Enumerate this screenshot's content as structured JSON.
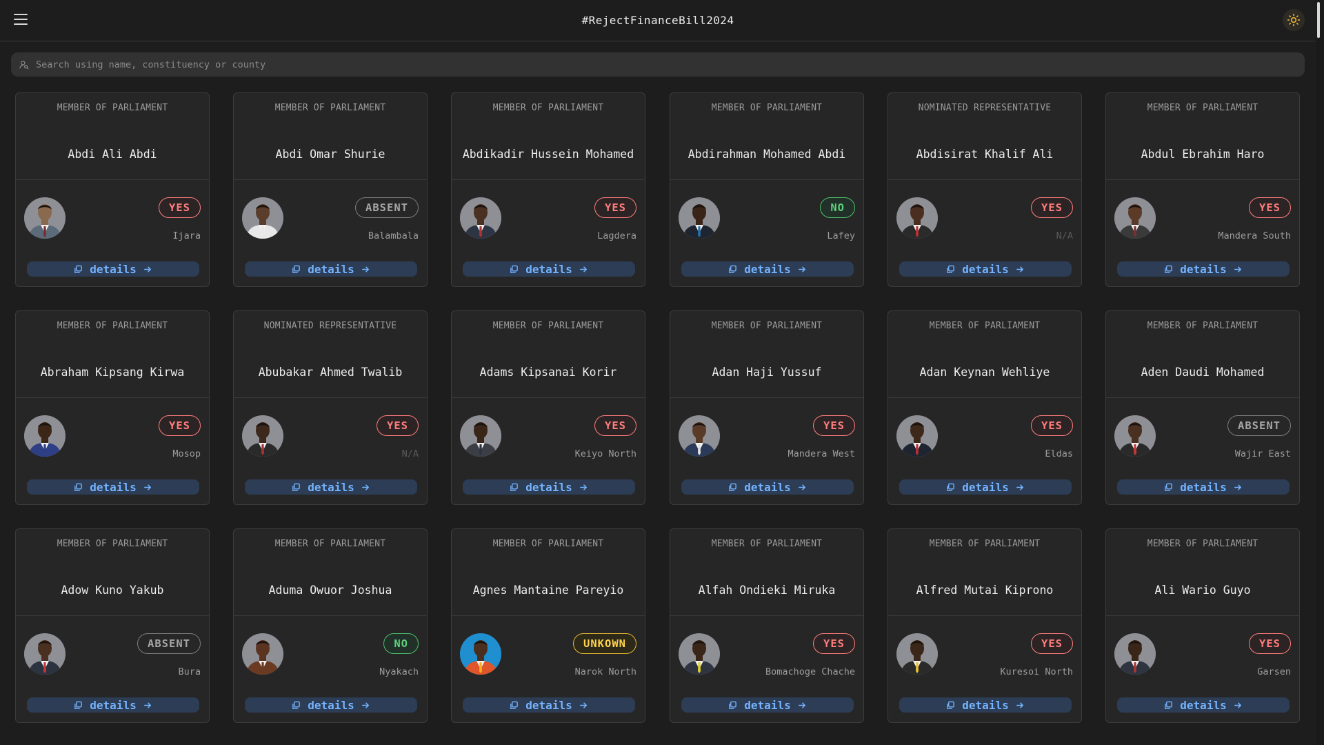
{
  "header": {
    "title": "#RejectFinanceBill2024"
  },
  "search": {
    "placeholder": "Search using name, constituency or county"
  },
  "details_label": "details",
  "colors": {
    "yes": "#ff7d7d",
    "no": "#5fd07a",
    "absent": "#a5a5a5",
    "unknown": "#ffd24d",
    "details": "#75b3ff"
  },
  "cards": [
    {
      "role": "MEMBER OF PARLIAMENT",
      "name": "Abdi Ali Abdi",
      "vote": "YES",
      "constituency": "Ijara",
      "skin": "#8a6a4e",
      "suit": "#5b6b7a",
      "tie": "#7a2e2e"
    },
    {
      "role": "MEMBER OF PARLIAMENT",
      "name": "Abdi Omar Shurie",
      "vote": "ABSENT",
      "constituency": "Balambala",
      "skin": "#5a3d2b",
      "suit": "#e8e8e8",
      "tie": "#e8e8e8"
    },
    {
      "role": "MEMBER OF PARLIAMENT",
      "name": "Abdikadir Hussein Mohamed",
      "vote": "YES",
      "constituency": "Lagdera",
      "skin": "#4b3122",
      "suit": "#2d3545",
      "tie": "#b03434"
    },
    {
      "role": "MEMBER OF PARLIAMENT",
      "name": "Abdirahman Mohamed Abdi",
      "vote": "NO",
      "constituency": "Lafey",
      "skin": "#3a2418",
      "suit": "#1f2530",
      "tie": "#2a6fa8"
    },
    {
      "role": "NOMINATED REPRESENTATIVE",
      "name": "Abdisirat Khalif Ali",
      "vote": "YES",
      "constituency": "N/A",
      "skin": "#4a2f20",
      "suit": "#2a2a2a",
      "tie": "#c03030"
    },
    {
      "role": "MEMBER OF PARLIAMENT",
      "name": "Abdul Ebrahim Haro",
      "vote": "YES",
      "constituency": "Mandera South",
      "skin": "#5b3a28",
      "suit": "#3a3a3a",
      "tie": "#7a3030"
    },
    {
      "role": "MEMBER OF PARLIAMENT",
      "name": "Abraham Kipsang Kirwa",
      "vote": "YES",
      "constituency": "Mosop",
      "skin": "#3b2618",
      "suit": "#2e3f86",
      "tie": "#2e3f86"
    },
    {
      "role": "NOMINATED REPRESENTATIVE",
      "name": "Abubakar Ahmed Twalib",
      "vote": "YES",
      "constituency": "N/A",
      "skin": "#3d281c",
      "suit": "#2a2a2a",
      "tie": "#a83232"
    },
    {
      "role": "MEMBER OF PARLIAMENT",
      "name": "Adams Kipsanai Korir",
      "vote": "YES",
      "constituency": "Keiyo North",
      "skin": "#3a2619",
      "suit": "#3b3e45",
      "tie": "#2f3340"
    },
    {
      "role": "MEMBER OF PARLIAMENT",
      "name": "Adan Haji Yussuf",
      "vote": "YES",
      "constituency": "Mandera West",
      "skin": "#5a3b28",
      "suit": "#2b3a58",
      "tie": "#e0e0e0"
    },
    {
      "role": "MEMBER OF PARLIAMENT",
      "name": "Adan Keynan Wehliye",
      "vote": "YES",
      "constituency": "Eldas",
      "skin": "#3e281a",
      "suit": "#1f2530",
      "tie": "#b83030"
    },
    {
      "role": "MEMBER OF PARLIAMENT",
      "name": "Aden Daudi Mohamed",
      "vote": "ABSENT",
      "constituency": "Wajir East",
      "skin": "#4a3020",
      "suit": "#2a2a2a",
      "tie": "#c83838"
    },
    {
      "role": "MEMBER OF PARLIAMENT",
      "name": "Adow Kuno Yakub",
      "vote": "ABSENT",
      "constituency": "Bura",
      "skin": "#4a3020",
      "suit": "#2b3240",
      "tie": "#c83838"
    },
    {
      "role": "MEMBER OF PARLIAMENT",
      "name": "Aduma Owuor Joshua",
      "vote": "NO",
      "constituency": "Nyakach",
      "skin": "#5a3420",
      "suit": "#6b3a22",
      "tie": "#6b3a22"
    },
    {
      "role": "MEMBER OF PARLIAMENT",
      "name": "Agnes Mantaine Pareyio",
      "vote": "UNKOWN",
      "constituency": "Narok North",
      "skin": "#4a2e1e",
      "suit": "#e0552a",
      "tie": "#f0b020",
      "bg": "#1f8fd0"
    },
    {
      "role": "MEMBER OF PARLIAMENT",
      "name": "Alfah Ondieki Miruka",
      "vote": "YES",
      "constituency": "Bomachoge Chache",
      "skin": "#3a2519",
      "suit": "#2e3440",
      "tie": "#e0d030"
    },
    {
      "role": "MEMBER OF PARLIAMENT",
      "name": "Alfred Mutai Kiprono",
      "vote": "YES",
      "constituency": "Kuresoi North",
      "skin": "#3b2719",
      "suit": "#2a2a2a",
      "tie": "#e8c030"
    },
    {
      "role": "MEMBER OF PARLIAMENT",
      "name": "Ali Wario Guyo",
      "vote": "YES",
      "constituency": "Garsen",
      "skin": "#3a2519",
      "suit": "#2e3440",
      "tie": "#b03434"
    }
  ]
}
